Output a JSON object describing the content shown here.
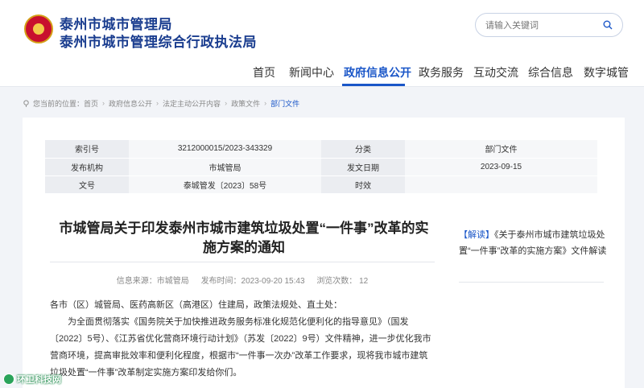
{
  "header": {
    "title_line1": "泰州市城市管理局",
    "title_line2": "泰州市城市管理综合行政执法局",
    "search_placeholder": "请输入关键词"
  },
  "nav": {
    "items": [
      {
        "label": "首页"
      },
      {
        "label": "新闻中心"
      },
      {
        "label": "政府信息公开",
        "active": true
      },
      {
        "label": "政务服务"
      },
      {
        "label": "互动交流"
      },
      {
        "label": "综合信息"
      },
      {
        "label": "数字城管"
      }
    ]
  },
  "breadcrumb": {
    "prefix": "您当前的位置：",
    "items": [
      "首页",
      "政府信息公开",
      "法定主动公开内容",
      "政策文件",
      "部门文件"
    ],
    "separator": "›"
  },
  "meta": {
    "rows": [
      [
        {
          "k": "索引号",
          "v": "3212000015/2023-343329"
        },
        {
          "k": "分类",
          "v": "部门文件"
        }
      ],
      [
        {
          "k": "发布机构",
          "v": "市城管局"
        },
        {
          "k": "发文日期",
          "v": "2023-09-15"
        }
      ],
      [
        {
          "k": "文号",
          "v": "泰城管发〔2023〕58号"
        },
        {
          "k": "时效",
          "v": ""
        }
      ]
    ]
  },
  "article": {
    "title": "市城管局关于印发泰州市城市建筑垃圾处置“一件事”改革的实施方案的通知",
    "source": "信息来源：市城管局",
    "time": "发布时间：2023-09-20 15:43",
    "views": "浏览次数：  12",
    "salutation": "各市（区）城管局、医药高新区（高港区）住建局，政策法规处、直土处：",
    "paragraph": "为全面贯彻落实《国务院关于加快推进政务服务标准化规范化便利化的指导意见》（国发〔2022〕5号）、《江苏省优化营商环境行动计划》（苏发〔2022〕9号）文件精神，进一步优化我市营商环境，提高审批效率和便利化程度，根据市“一件事一次办”改革工作要求，现将我市城市建筑垃圾处置“一件事”改革制定实施方案印发给你们。"
  },
  "sidebar": {
    "tag": "【解读】",
    "link": "《关于泰州市城市建筑垃圾处置“一件事”改革的实施方案》文件解读"
  },
  "watermark": {
    "text": "环卫科技网"
  },
  "colors": {
    "primary": "#1a56c8",
    "title": "#1a3d8f",
    "page_bg": "#f2f4f8"
  }
}
